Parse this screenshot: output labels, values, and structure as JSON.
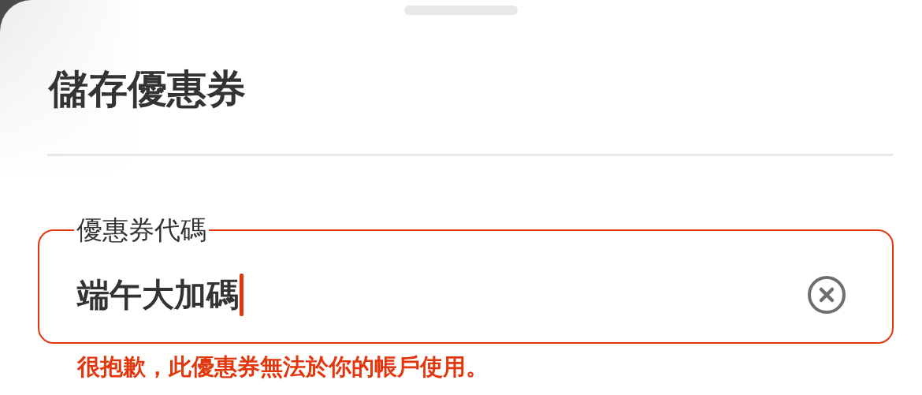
{
  "sheet": {
    "title": "儲存優惠券"
  },
  "coupon_field": {
    "label": "優惠券代碼",
    "value": "端午大加碼",
    "focused": true,
    "error": true,
    "error_message": "很抱歉，此優惠券無法於你的帳戶使用。"
  }
}
